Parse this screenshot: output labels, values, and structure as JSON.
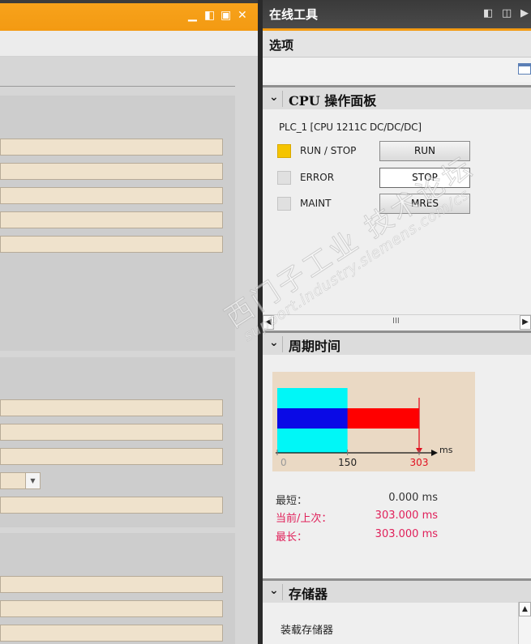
{
  "online_tools": {
    "title": "在线工具",
    "options_label": "选项"
  },
  "cpu_panel": {
    "title": "CPU 操作面板",
    "device": "PLC_1 [CPU 1211C DC/DC/DC]",
    "indicators": [
      {
        "label": "RUN / STOP",
        "color": "#f5c400",
        "lit": true
      },
      {
        "label": "ERROR",
        "color": "#e0e0e0",
        "lit": false
      },
      {
        "label": "MAINT",
        "color": "#e0e0e0",
        "lit": false
      }
    ],
    "buttons": [
      {
        "label": "RUN",
        "active": false
      },
      {
        "label": "STOP",
        "active": true
      },
      {
        "label": "MRES",
        "active": false
      }
    ],
    "scroll_grip": "III"
  },
  "cycle_time": {
    "title": "周期时间",
    "chart_data": {
      "type": "bar",
      "unit": "ms",
      "ticks": [
        0,
        150,
        303
      ],
      "tick_labels": [
        "0",
        "150",
        "303"
      ],
      "xlim": [
        0,
        303
      ],
      "bars": [
        {
          "name": "shortest",
          "from": 0,
          "to": 150,
          "color": "#00f7f7",
          "row": "full"
        },
        {
          "name": "longest",
          "from": 0,
          "to": 303,
          "color": "#ff0000",
          "row": "middle"
        },
        {
          "name": "current",
          "from": 0,
          "to": 150,
          "color": "#0a0ae6",
          "row": "middle"
        }
      ],
      "marker": 303,
      "marker_color": "#e01020"
    },
    "stats": [
      {
        "label": "最短：",
        "value": "0.000 ms",
        "color": "#333333"
      },
      {
        "label": "当前/上次：",
        "value": "303.000 ms",
        "color": "#e0205a"
      },
      {
        "label": "最长：",
        "value": "303.000 ms",
        "color": "#e0205a"
      }
    ]
  },
  "memory": {
    "title": "存储器",
    "load_memory_label": "装载存储器"
  },
  "watermark": {
    "text1": "西门子工业 技术论坛",
    "text2": "support.industry.siemens.com/cs"
  }
}
